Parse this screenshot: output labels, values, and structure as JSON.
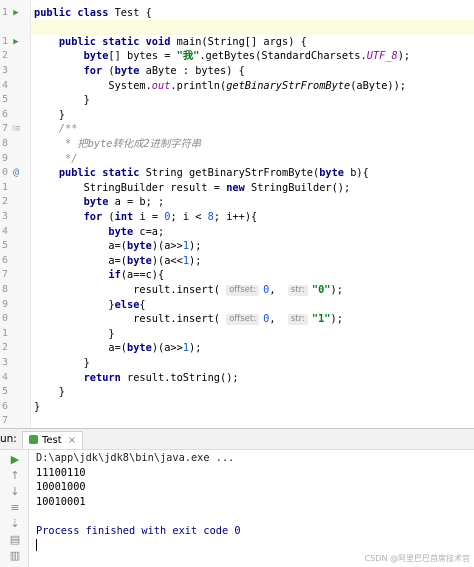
{
  "editor": {
    "lines": [
      {
        "n": "",
        "icon": "",
        "html": ""
      },
      {
        "n": "1",
        "icon": "run",
        "segments": [
          [
            "kw",
            "public class "
          ],
          [
            "",
            "Test {"
          ]
        ]
      },
      {
        "n": "",
        "icon": "",
        "segments": []
      },
      {
        "n": "1",
        "icon": "run",
        "segments": [
          [
            "",
            "    "
          ],
          [
            "kw",
            "public static void "
          ],
          [
            "",
            "main(String[] args) {"
          ]
        ]
      },
      {
        "n": "2",
        "icon": "",
        "segments": [
          [
            "",
            "        "
          ],
          [
            "kw",
            "byte"
          ],
          [
            "",
            "[] bytes = "
          ],
          [
            "str",
            "\"我\""
          ],
          [
            "",
            ".getBytes(StandardCharsets."
          ],
          [
            "fld",
            "UTF_8"
          ],
          [
            "",
            ");"
          ]
        ]
      },
      {
        "n": "3",
        "icon": "",
        "segments": [
          [
            "",
            "        "
          ],
          [
            "kw",
            "for "
          ],
          [
            "",
            "("
          ],
          [
            "kw",
            "byte "
          ],
          [
            "",
            "aByte : bytes) {"
          ]
        ]
      },
      {
        "n": "4",
        "icon": "",
        "segments": [
          [
            "",
            "            System."
          ],
          [
            "fld",
            "out"
          ],
          [
            "",
            ".println("
          ],
          [
            "stc",
            "getBinaryStrFromByte"
          ],
          [
            "",
            "(aByte));"
          ]
        ]
      },
      {
        "n": "5",
        "icon": "",
        "segments": [
          [
            "",
            "        }"
          ]
        ]
      },
      {
        "n": "6",
        "icon": "",
        "segments": [
          [
            "",
            "    }"
          ]
        ]
      },
      {
        "n": "7",
        "icon": "doc",
        "segments": [
          [
            "cmt",
            "    /**"
          ]
        ]
      },
      {
        "n": "8",
        "icon": "",
        "segments": [
          [
            "cmt",
            "     * 把byte转化成2进制字符串"
          ]
        ]
      },
      {
        "n": "9",
        "icon": "",
        "segments": [
          [
            "cmt",
            "     */"
          ]
        ]
      },
      {
        "n": "0",
        "icon": "ovr",
        "segments": [
          [
            "",
            "    "
          ],
          [
            "kw",
            "public static "
          ],
          [
            "",
            "String getBinaryStrFromByte("
          ],
          [
            "kw",
            "byte "
          ],
          [
            "",
            "b){"
          ]
        ]
      },
      {
        "n": "1",
        "icon": "",
        "segments": [
          [
            "",
            "        StringBuilder result = "
          ],
          [
            "kw",
            "new "
          ],
          [
            "",
            "StringBuilder();"
          ]
        ]
      },
      {
        "n": "2",
        "icon": "",
        "segments": [
          [
            "",
            "        "
          ],
          [
            "kw",
            "byte "
          ],
          [
            "",
            "a = b; ;"
          ]
        ]
      },
      {
        "n": "3",
        "icon": "",
        "segments": [
          [
            "",
            "        "
          ],
          [
            "kw",
            "for "
          ],
          [
            "",
            "("
          ],
          [
            "kw",
            "int "
          ],
          [
            "",
            "i = "
          ],
          [
            "num",
            "0"
          ],
          [
            "",
            "; i < "
          ],
          [
            "num",
            "8"
          ],
          [
            "",
            "; i++){"
          ]
        ]
      },
      {
        "n": "4",
        "icon": "",
        "segments": [
          [
            "",
            "            "
          ],
          [
            "kw",
            "byte "
          ],
          [
            "",
            "c=a;"
          ]
        ]
      },
      {
        "n": "5",
        "icon": "",
        "segments": [
          [
            "",
            "            a=("
          ],
          [
            "kw",
            "byte"
          ],
          [
            "",
            ")(a>>"
          ],
          [
            "num",
            "1"
          ],
          [
            "",
            ");"
          ]
        ]
      },
      {
        "n": "6",
        "icon": "",
        "segments": [
          [
            "",
            "            a=("
          ],
          [
            "kw",
            "byte"
          ],
          [
            "",
            ")(a<<"
          ],
          [
            "num",
            "1"
          ],
          [
            "",
            ");"
          ]
        ]
      },
      {
        "n": "7",
        "icon": "",
        "segments": [
          [
            "",
            "            "
          ],
          [
            "kw",
            "if"
          ],
          [
            "",
            "(a==c){"
          ]
        ]
      },
      {
        "n": "8",
        "icon": "",
        "segments": [
          [
            "",
            "                result.insert( "
          ],
          [
            "hint",
            "offset:"
          ],
          [
            "num",
            "0"
          ],
          [
            "",
            ",  "
          ],
          [
            "hint",
            "str:"
          ],
          [
            "str",
            "\"0\""
          ],
          [
            "",
            ");"
          ]
        ]
      },
      {
        "n": "9",
        "icon": "",
        "segments": [
          [
            "",
            "            }"
          ],
          [
            "kw",
            "else"
          ],
          [
            "",
            "{"
          ]
        ]
      },
      {
        "n": "0",
        "icon": "",
        "segments": [
          [
            "",
            "                result.insert( "
          ],
          [
            "hint",
            "offset:"
          ],
          [
            "num",
            "0"
          ],
          [
            "",
            ",  "
          ],
          [
            "hint",
            "str:"
          ],
          [
            "str",
            "\"1\""
          ],
          [
            "",
            ");"
          ]
        ]
      },
      {
        "n": "1",
        "icon": "",
        "segments": [
          [
            "",
            "            }"
          ]
        ]
      },
      {
        "n": "2",
        "icon": "",
        "segments": [
          [
            "",
            "            a=("
          ],
          [
            "kw",
            "byte"
          ],
          [
            "",
            ")(a>>"
          ],
          [
            "num",
            "1"
          ],
          [
            "",
            ");"
          ]
        ]
      },
      {
        "n": "3",
        "icon": "",
        "segments": [
          [
            "",
            "        }"
          ]
        ]
      },
      {
        "n": "4",
        "icon": "",
        "segments": [
          [
            "",
            "        "
          ],
          [
            "kw",
            "return "
          ],
          [
            "",
            "result.toString();"
          ]
        ]
      },
      {
        "n": "5",
        "icon": "",
        "segments": [
          [
            "",
            "    }"
          ]
        ]
      },
      {
        "n": "6",
        "icon": "",
        "segments": [
          [
            "",
            "}"
          ]
        ]
      },
      {
        "n": "7",
        "icon": "",
        "segments": []
      }
    ]
  },
  "run_panel": {
    "label": "un:",
    "tab_label": "Test",
    "tab_close": "×",
    "console_lines": [
      {
        "cls": "cmd",
        "text": "D:\\app\\jdk\\jdk8\\bin\\java.exe ..."
      },
      {
        "cls": "",
        "text": "11100110"
      },
      {
        "cls": "",
        "text": "10001000"
      },
      {
        "cls": "",
        "text": "10010001"
      },
      {
        "cls": "",
        "text": ""
      },
      {
        "cls": "proc",
        "text": "Process finished with exit code 0"
      }
    ],
    "side_icons": [
      "rerun-icon",
      "up-arrow-icon",
      "down-arrow-icon",
      "soft-wrap-icon",
      "scroll-end-icon",
      "print-icon",
      "trash-icon"
    ]
  },
  "watermark": "CSDN @阿里巴巴首席技术官",
  "colors": {
    "keyword": "#000080",
    "string": "#067d17",
    "field": "#871094",
    "comment": "#8c8c8c",
    "number": "#1750eb"
  }
}
